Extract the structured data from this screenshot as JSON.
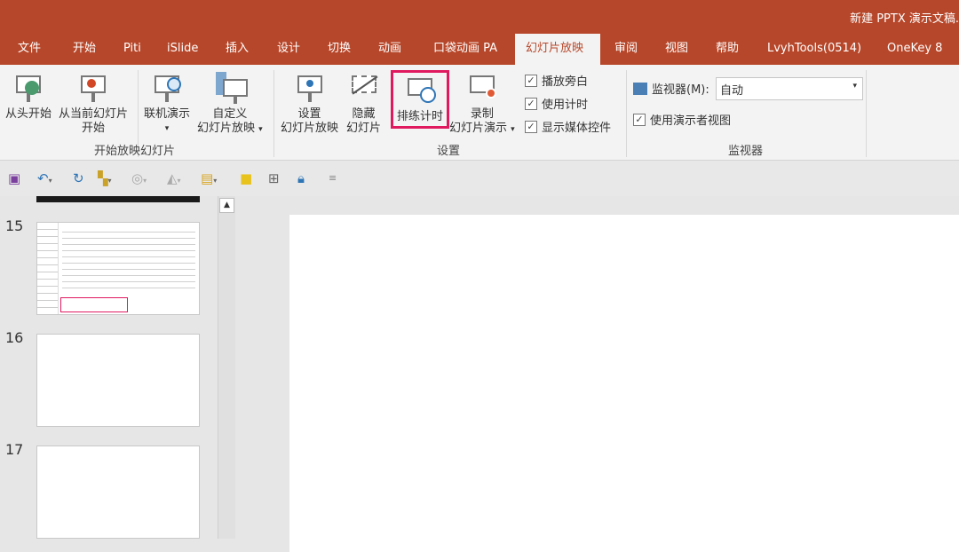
{
  "window": {
    "title": "新建 PPTX 演示文稿."
  },
  "tabs": [
    "文件",
    "开始",
    "Piti",
    "iSlide",
    "插入",
    "设计",
    "切换",
    "动画",
    "口袋动画 PA",
    "幻灯片放映",
    "审阅",
    "视图",
    "帮助",
    "LvyhTools(0514)",
    "OneKey 8"
  ],
  "active_tab": "幻灯片放映",
  "ribbon": {
    "start_group": {
      "label": "开始放映幻灯片",
      "from_beginning": "从头开始",
      "from_current_1": "从当前幻灯片",
      "from_current_2": "开始",
      "online": "联机演示",
      "custom_1": "自定义",
      "custom_2": "幻灯片放映"
    },
    "setup_group": {
      "label": "设置",
      "setup_1": "设置",
      "setup_2": "幻灯片放映",
      "hide_1": "隐藏",
      "hide_2": "幻灯片",
      "rehearse": "排练计时",
      "record_1": "录制",
      "record_2": "幻灯片演示",
      "play_narrations": "播放旁白",
      "use_timings": "使用计时",
      "show_media_controls": "显示媒体控件"
    },
    "monitor_group": {
      "label": "监视器",
      "monitor_label": "监视器(M):",
      "monitor_value": "自动",
      "presenter_view": "使用演示者视图"
    }
  },
  "slides": {
    "numbers": [
      "15",
      "16",
      "17"
    ]
  },
  "colors": {
    "brand": "#b7472a",
    "highlight": "#e0195f"
  }
}
